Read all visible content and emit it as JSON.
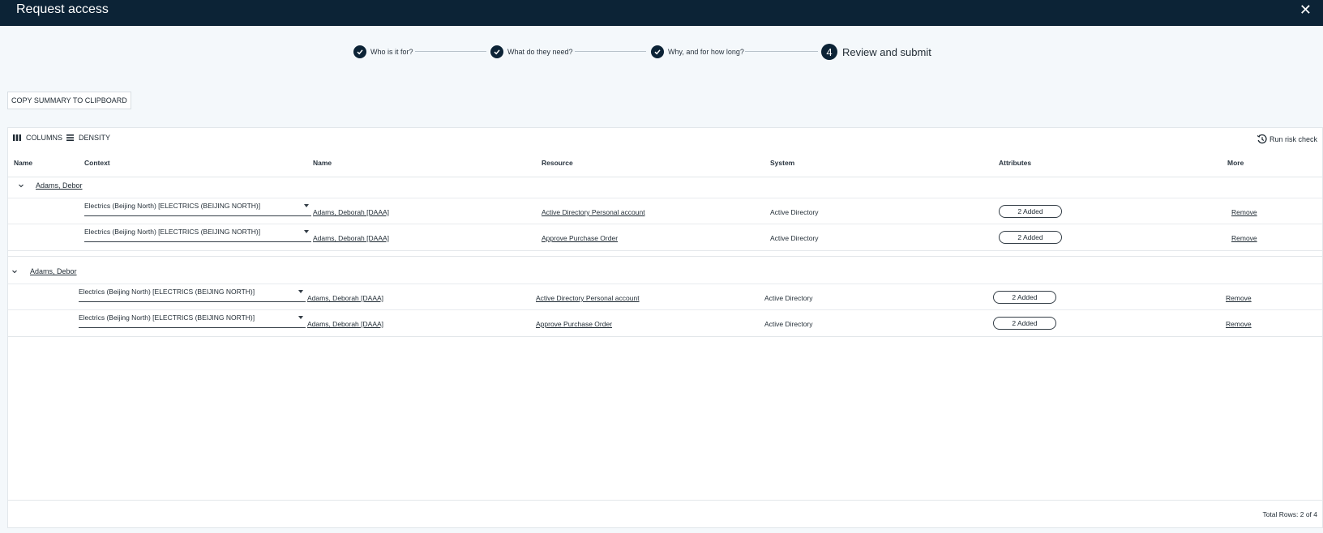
{
  "window": {
    "title": "Request access",
    "close_glyph": "✕"
  },
  "stepper": {
    "steps": [
      {
        "label": "Who is it for?",
        "state": "done"
      },
      {
        "label": "What do they need?",
        "state": "done"
      },
      {
        "label": "Why, and for how long?",
        "state": "done"
      },
      {
        "number": "4",
        "label": "Review and submit",
        "state": "current"
      }
    ]
  },
  "actions": {
    "copy_summary": "COPY SUMMARY TO CLIPBOARD"
  },
  "toolbar": {
    "columns": "COLUMNS",
    "density": "DENSITY",
    "run_risk_check": "Run risk check"
  },
  "table": {
    "headers": [
      "Name",
      "Context",
      "Name",
      "Resource",
      "System",
      "Attributes",
      "More"
    ],
    "groups": [
      {
        "name": "Adams, Debor",
        "rows": [
          {
            "context": "Electrics (Beijing North) [ELECTRICS (BEIJING NORTH)]",
            "name": "Adams, Deborah [DAAA]",
            "resource": "Active Directory Personal account",
            "system": "Active Directory",
            "attributes": "2 Added",
            "more": "Remove"
          },
          {
            "context": "Electrics (Beijing North) [ELECTRICS (BEIJING NORTH)]",
            "name": "Adams, Deborah [DAAA]",
            "resource": "Approve Purchase Order",
            "system": "Active Directory",
            "attributes": "2 Added",
            "more": "Remove"
          }
        ]
      },
      {
        "name": "Adams, Debor",
        "rows": [
          {
            "context": "Electrics (Beijing North) [ELECTRICS (BEIJING NORTH)]",
            "name": "Adams, Deborah [DAAA]",
            "resource": "Active Directory Personal account",
            "system": "Active Directory",
            "attributes": "2 Added",
            "more": "Remove"
          },
          {
            "context": "Electrics (Beijing North) [ELECTRICS (BEIJING NORTH)]",
            "name": "Adams, Deborah [DAAA]",
            "resource": "Approve Purchase Order",
            "system": "Active Directory",
            "attributes": "2 Added",
            "more": "Remove"
          }
        ]
      }
    ],
    "footer": "Total Rows: 2 of 4"
  },
  "colors": {
    "header_bg": "#0c2336",
    "page_bg": "#f4f8fb",
    "step_dot": "#0c2336"
  },
  "icons": {
    "step_done": "check-icon",
    "columns": "columns-icon",
    "density": "density-icon",
    "risk": "history-icon",
    "group_toggle": "chevron-down-icon"
  }
}
